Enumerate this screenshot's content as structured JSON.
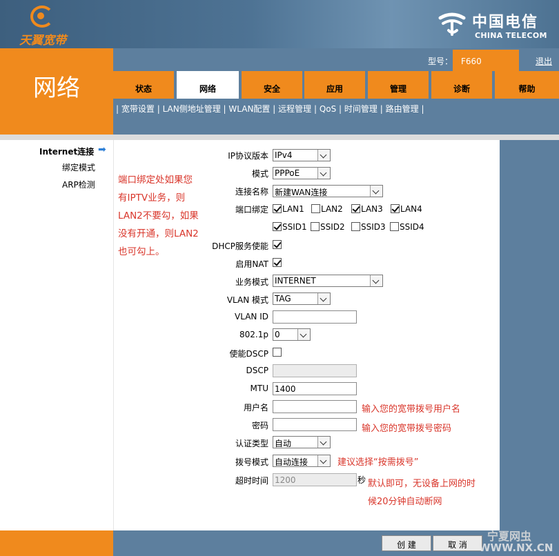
{
  "brand": {
    "text": "天翼宽带",
    "telecom_cn": "中国电信",
    "telecom_en": "CHINA TELECOM"
  },
  "page_title": "网络",
  "header": {
    "model_label": "型号：",
    "model_value": "F660",
    "logout": "退出"
  },
  "tabs": [
    "状态",
    "网络",
    "安全",
    "应用",
    "管理",
    "诊断",
    "帮助"
  ],
  "subnav": [
    "宽带设置",
    "LAN侧地址管理",
    "WLAN配置",
    "远程管理",
    "QoS",
    "时间管理",
    "路由管理"
  ],
  "left_menu": {
    "internet": "Internet连接",
    "bind": "绑定模式",
    "arp": "ARP检测"
  },
  "left_note": [
    "端口绑定处如果您",
    "有IPTV业务，则",
    "LAN2不要勾，如果",
    "没有开通，则LAN2",
    "也可勾上。"
  ],
  "form": {
    "ip_version": {
      "label": "IP协议版本",
      "value": "IPv4"
    },
    "mode": {
      "label": "模式",
      "value": "PPPoE"
    },
    "conn_name": {
      "label": "连接名称",
      "value": "新建WAN连接"
    },
    "port_bind": {
      "label": "端口绑定",
      "lan": [
        {
          "name": "LAN1",
          "checked": true
        },
        {
          "name": "LAN2",
          "checked": false
        },
        {
          "name": "LAN3",
          "checked": true
        },
        {
          "name": "LAN4",
          "checked": true
        }
      ],
      "ssid": [
        {
          "name": "SSID1",
          "checked": true
        },
        {
          "name": "SSID2",
          "checked": false
        },
        {
          "name": "SSID3",
          "checked": false
        },
        {
          "name": "SSID4",
          "checked": false
        }
      ]
    },
    "dhcp": {
      "label": "DHCP服务使能",
      "checked": true
    },
    "nat": {
      "label": "启用NAT",
      "checked": true
    },
    "service_mode": {
      "label": "业务模式",
      "value": "INTERNET"
    },
    "vlan_mode": {
      "label": "VLAN 模式",
      "value": "TAG"
    },
    "vlan_id": {
      "label": "VLAN ID",
      "value": ""
    },
    "p8021": {
      "label": "802.1p",
      "value": "0"
    },
    "dscp_enable": {
      "label": "使能DSCP",
      "checked": false
    },
    "dscp": {
      "label": "DSCP",
      "value": ""
    },
    "mtu": {
      "label": "MTU",
      "value": "1400"
    },
    "username": {
      "label": "用户名",
      "value": "",
      "note": "输入您的宽带拨号用户名"
    },
    "password": {
      "label": "密码",
      "value": "",
      "note": "输入您的宽带拨号密码"
    },
    "auth_type": {
      "label": "认证类型",
      "value": "自动"
    },
    "dial_mode": {
      "label": "拨号模式",
      "value": "自动连接",
      "note": "建议选择“按需拨号”"
    },
    "timeout": {
      "label": "超时时间",
      "value": "1200",
      "unit": "秒",
      "note1": "默认即可，无设备上网的时",
      "note2": "候20分钟自动断网"
    }
  },
  "buttons": {
    "create": "创 建",
    "cancel": "取 消"
  },
  "watermark": {
    "line1": "宁夏网虫",
    "line2": "WWW.NX.CN"
  },
  "colors": {
    "orange": "#f08a1d",
    "slate": "#5d7f9e",
    "note_red": "#d9362b"
  }
}
